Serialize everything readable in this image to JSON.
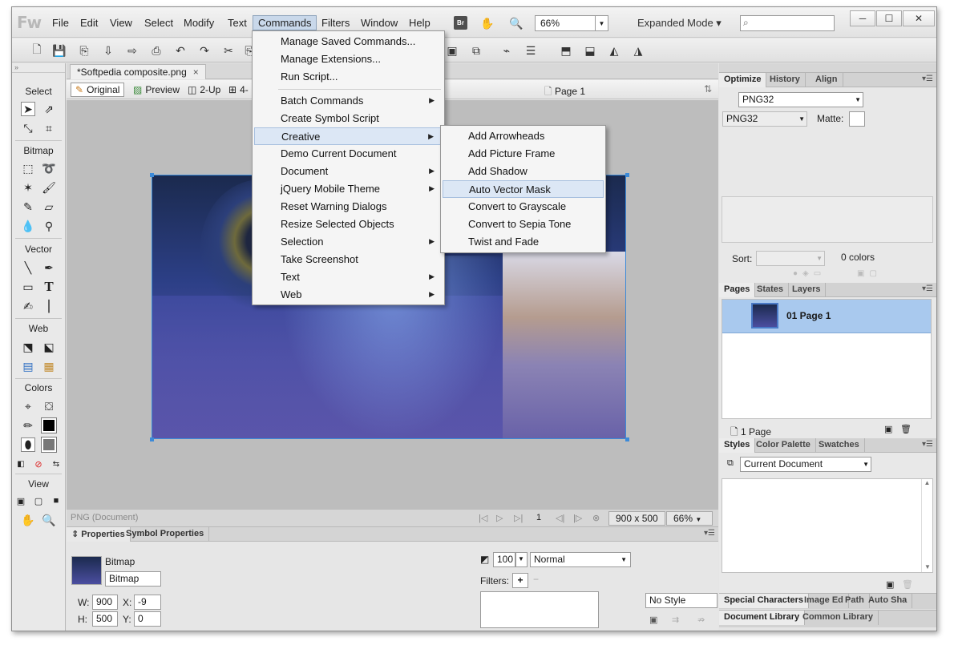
{
  "app": {
    "logo": "Fw",
    "mode": "Expanded Mode",
    "zoom": "66%"
  },
  "menubar": {
    "items": [
      "File",
      "Edit",
      "View",
      "Select",
      "Modify",
      "Text",
      "Commands",
      "Filters",
      "Window",
      "Help"
    ],
    "bridge": "Br"
  },
  "window_controls": {
    "minimize": "─",
    "maximize": "☐",
    "close": "✕"
  },
  "commands_menu": {
    "items": [
      {
        "label": "Manage Saved Commands..."
      },
      {
        "label": "Manage Extensions..."
      },
      {
        "label": "Run Script..."
      },
      {
        "label": "Batch Commands"
      },
      {
        "label": "Create Symbol Script"
      },
      {
        "label": "Creative"
      },
      {
        "label": "Demo Current Document"
      },
      {
        "label": "Document"
      },
      {
        "label": "jQuery Mobile Theme"
      },
      {
        "label": "Reset Warning Dialogs"
      },
      {
        "label": "Resize Selected Objects"
      },
      {
        "label": "Selection"
      },
      {
        "label": "Take Screenshot"
      },
      {
        "label": "Text"
      },
      {
        "label": "Web"
      }
    ]
  },
  "creative_submenu": {
    "items": [
      "Add Arrowheads",
      "Add Picture Frame",
      "Add Shadow",
      "Auto Vector Mask",
      "Convert to Grayscale",
      "Convert to Sepia Tone",
      "Twist and Fade"
    ]
  },
  "tools_panel": {
    "sections": [
      "Select",
      "Bitmap",
      "Vector",
      "Web",
      "Colors",
      "View"
    ]
  },
  "document": {
    "tab": "*Softpedia composite.png",
    "tab_close": "×",
    "views": [
      "Original",
      "Preview",
      "2-Up",
      "4-"
    ],
    "page": "Page 1",
    "status": "PNG (Document)",
    "page_num": "1",
    "size": "900 x 500",
    "zoom": "66%"
  },
  "properties": {
    "tabs": [
      "Properties",
      "Symbol Properties"
    ],
    "object_type": "Bitmap",
    "name": "Bitmap",
    "w": "900",
    "h": "500",
    "x": "-9",
    "y": "0",
    "w_label": "W:",
    "h_label": "H:",
    "x_label": "X:",
    "y_label": "Y:",
    "opacity": "100",
    "blend": "Normal",
    "filters_label": "Filters:",
    "filter_add": "+",
    "style": "No Style"
  },
  "optimize_panel": {
    "tabs": [
      "Optimize",
      "History",
      "Align"
    ],
    "format_preset": "PNG32",
    "format": "PNG32",
    "matte_label": "Matte:",
    "sort_label": "Sort:",
    "colors": "0 colors"
  },
  "pages_panel": {
    "tabs": [
      "Pages",
      "States",
      "Layers"
    ],
    "page_name": "01  Page 1",
    "footer": "1 Page"
  },
  "styles_panel": {
    "tabs": [
      "Styles",
      "Color Palette",
      "Swatches"
    ],
    "source": "Current Document"
  },
  "bottom_tabs_1": [
    "Special Characters",
    "Image Ed",
    "Path",
    "Auto Sha"
  ],
  "bottom_tabs_2": [
    "Document Library",
    "Common Library"
  ]
}
